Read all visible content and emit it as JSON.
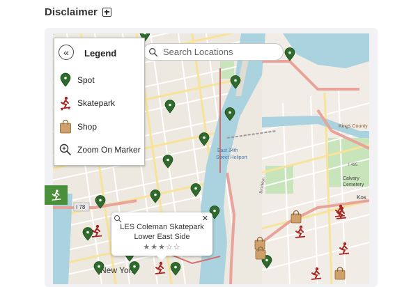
{
  "header": {
    "title": "Disclaimer"
  },
  "search": {
    "placeholder": "Search Locations"
  },
  "legend": {
    "title": "Legend",
    "items": [
      {
        "icon": "spot-pin-icon",
        "label": "Spot"
      },
      {
        "icon": "skatepark-icon",
        "label": "Skatepark"
      },
      {
        "icon": "shop-bag-icon",
        "label": "Shop"
      },
      {
        "icon": "zoom-magnifier-icon",
        "label": "Zoom On Marker"
      }
    ]
  },
  "popup": {
    "title": "LES Coleman Skatepark",
    "subtitle": "Lower East Side",
    "stars": "★★★☆☆",
    "rating": 3,
    "rating_max": 5
  },
  "map_labels": {
    "east34": "East 34th",
    "heliport": "Street Heliport",
    "i78": "I 78",
    "newyork": "New York",
    "kings": "Kings County",
    "calvary": "Calvary",
    "cemetery": "Cemetery",
    "kos": "Kos",
    "i495": "I 495",
    "brooklyn": "Brooklyn"
  },
  "colors": {
    "spot": "#2f6b2c",
    "skatepark": "#a8251f",
    "shop": "#cfa06a",
    "water": "#aad3df",
    "park": "#c8e4bb",
    "highway": "#e8a39a",
    "side_button": "#4a8f3a"
  }
}
